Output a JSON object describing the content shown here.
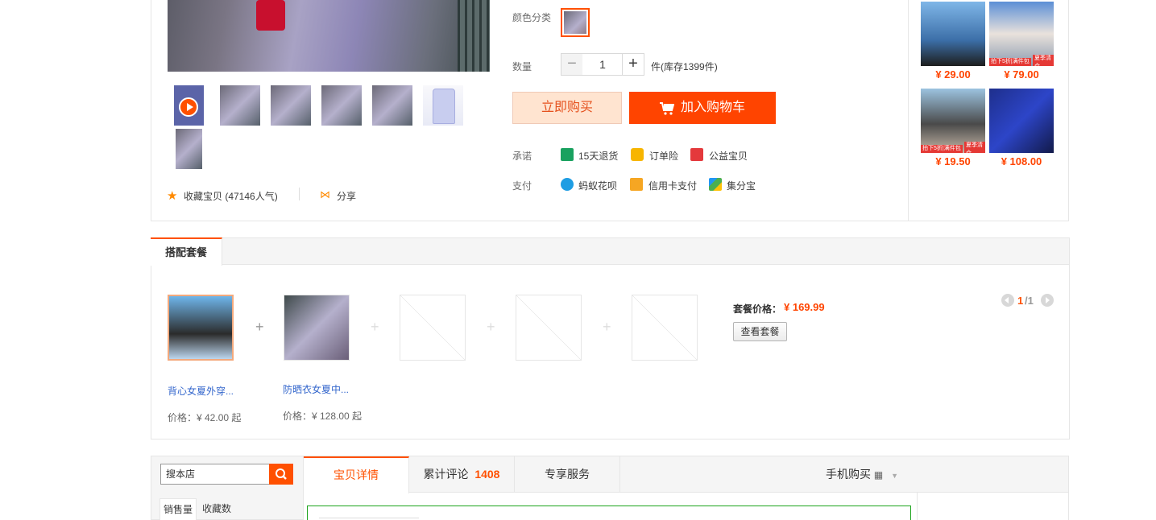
{
  "product": {
    "color_label": "颜色分类",
    "qty_label": "数量",
    "qty_value": "1",
    "stock_text": "件(库存1399件)",
    "buy_now": "立即购买",
    "add_cart": "加入购物车",
    "promise_label": "承诺",
    "promises": [
      "15天退货",
      "订单险",
      "公益宝贝"
    ],
    "pay_label": "支付",
    "payments": [
      "蚂蚁花呗",
      "信用卡支付",
      "集分宝"
    ],
    "favorite": "收藏宝贝 (47146人气)",
    "share": "分享"
  },
  "recommendations": [
    {
      "price": "¥ 29.00"
    },
    {
      "price": "¥ 79.00"
    },
    {
      "price": "¥ 19.50"
    },
    {
      "price": "¥ 108.00"
    }
  ],
  "combo": {
    "tab": "搭配套餐",
    "price_label": "套餐价格：",
    "price": "¥ 169.99",
    "view_button": "查看套餐",
    "page_current": "1",
    "page_total": "/1",
    "items": [
      {
        "name": "背心女夏外穿...",
        "price": "价格：¥ 42.00 起"
      },
      {
        "name": "防晒衣女夏中...",
        "price": "价格：¥ 128.00 起"
      }
    ]
  },
  "shop": {
    "search_placeholder": "搜本店",
    "sort_sales": "销售量",
    "sort_fav": "收藏数"
  },
  "tabs": {
    "detail": "宝贝详情",
    "reviews_label": "累计评论",
    "reviews_count": "1408",
    "service": "专享服务",
    "mobile": "手机购买"
  },
  "colors": {
    "accent": "#ff5000",
    "price": "#ff4400",
    "link": "#3366cc"
  }
}
